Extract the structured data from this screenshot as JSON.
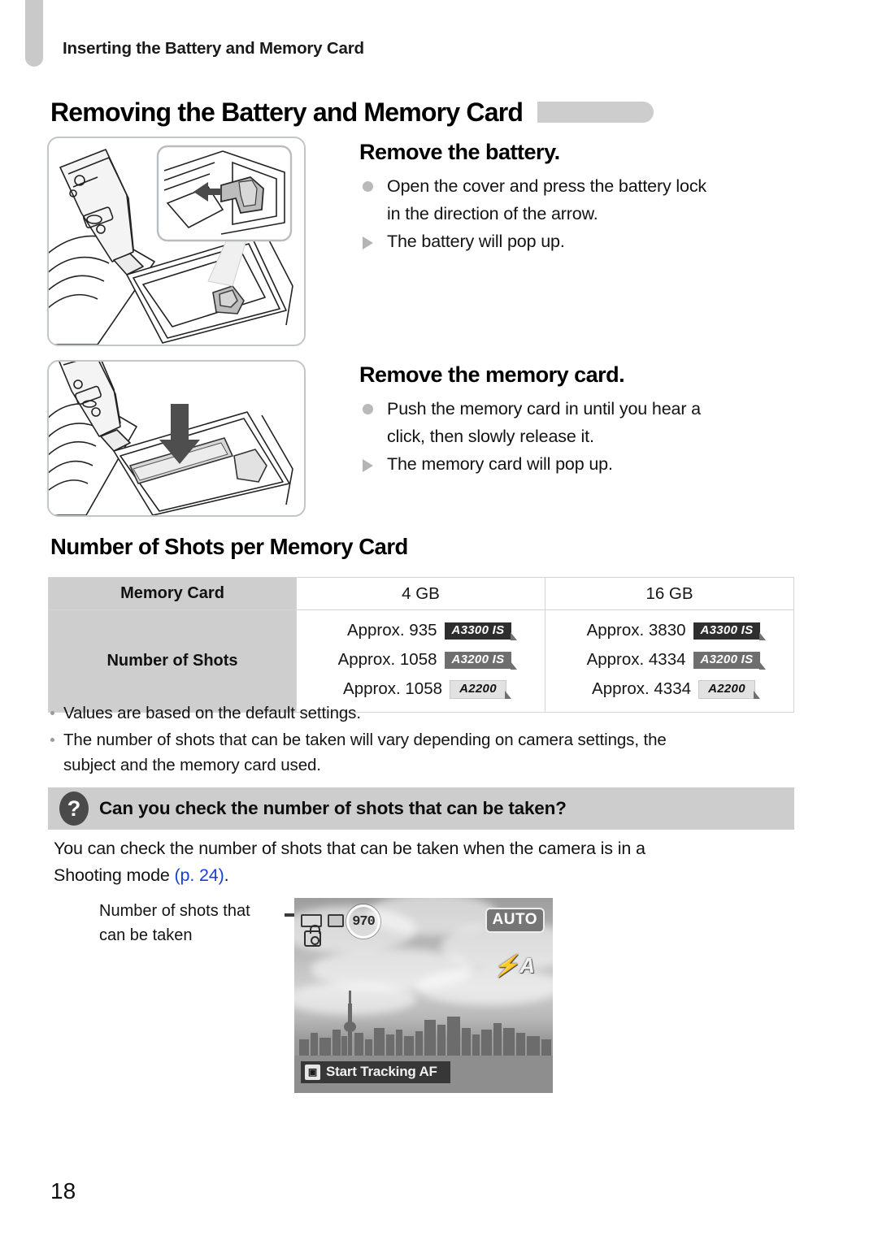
{
  "header": {
    "running_title": "Inserting the Battery and Memory Card",
    "page_title": "Removing the Battery and Memory Card"
  },
  "steps": [
    {
      "title": "Remove the battery.",
      "bullet": "Open the cover and press the battery lock",
      "bullet_cont": "in the direction of the arrow.",
      "result": "The battery will pop up."
    },
    {
      "title": "Remove the memory card.",
      "bullet": "Push the memory card in until you hear a",
      "bullet_cont": "click, then slowly release it.",
      "result": "The memory card will pop up."
    }
  ],
  "table_section": {
    "heading": "Number of Shots per Memory Card",
    "row_headers": [
      "Memory Card",
      "Number of Shots"
    ],
    "columns": [
      "4 GB",
      "16 GB"
    ],
    "shots": {
      "4gb": [
        {
          "value": "Approx. 935",
          "model": "A3300 IS",
          "style": "dark"
        },
        {
          "value": "Approx. 1058",
          "model": "A3200 IS",
          "style": "mid"
        },
        {
          "value": "Approx. 1058",
          "model": "A2200",
          "style": "light"
        }
      ],
      "16gb": [
        {
          "value": "Approx. 3830",
          "model": "A3300 IS",
          "style": "dark"
        },
        {
          "value": "Approx. 4334",
          "model": "A3200 IS",
          "style": "mid"
        },
        {
          "value": "Approx. 4334",
          "model": "A2200",
          "style": "light"
        }
      ]
    }
  },
  "notes": [
    "Values are based on the default settings.",
    "The number of shots that can be taken will vary depending on camera settings, the",
    "subject and the memory card used."
  ],
  "question_box": {
    "icon": "question-mark-icon",
    "title": "Can you check the number of shots that can be taken?",
    "body_line1": "You can check the number of shots that can be taken when the camera is in a",
    "body_line2_prefix": "Shooting mode ",
    "page_ref": "(p. 24)",
    "body_line2_suffix": "."
  },
  "callout": {
    "line1": "Number of shots that",
    "line2": "can be taken"
  },
  "lcd": {
    "shots_remaining": "970",
    "mode_badge": "AUTO",
    "flash_icon": "flash-auto-icon",
    "tracking_label": "Start Tracking AF",
    "tracking_icon": "frame-select-icon",
    "card_icon": "memory-card-icon",
    "battery_icon": "battery-icon",
    "lock_icon": "image-stabilizer-icon"
  },
  "footer": {
    "page_number": "18"
  },
  "colors": {
    "tab_gray": "#c9c9c9",
    "title_deco": "#cdcdcd",
    "table_header": "#cecece",
    "qbox_bg": "#cdcdcd",
    "page_ref_blue": "#1a3fd6",
    "badge_dark": "#2e2e2e",
    "badge_mid": "#6e6e6e",
    "badge_light": "#e2e2e2"
  }
}
